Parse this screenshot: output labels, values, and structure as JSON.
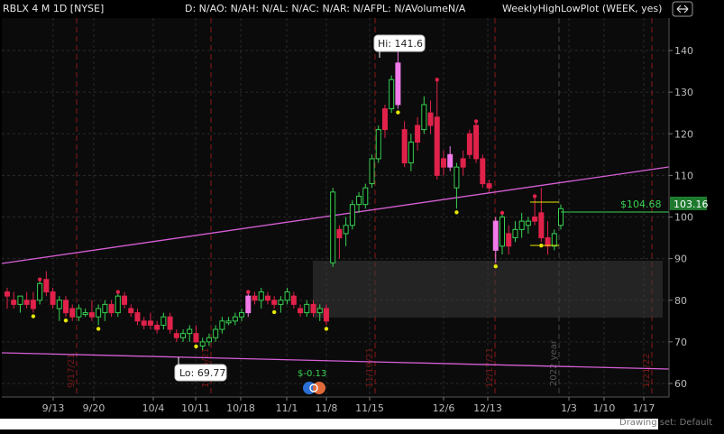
{
  "header": {
    "symbol": "RBLX 4 M 1D [NYSE]",
    "study_values": "D: N/AO: N/AH: N/AL: N/AC: N/AR: N/AFPL: N/AVolumeN/A",
    "study_name": "WeeklyHighLowPlot (WEEK, yes)"
  },
  "labels": {
    "hi": "Hi: 141.6",
    "lo": "Lo: 69.77",
    "price_level": "$104.68",
    "current_price": "103.16",
    "dividend_marker": "$-0.13",
    "year_marker": "2022 year",
    "drawing_set": "Drawing set: Default"
  },
  "y_axis": {
    "ticks": [
      "140",
      "130",
      "120",
      "110",
      "100",
      "90",
      "80",
      "70",
      "60"
    ]
  },
  "x_axis": {
    "ticks": [
      "9/13",
      "9/20",
      "10/4",
      "10/11",
      "10/18",
      "11/1",
      "11/8",
      "11/15",
      "12/6",
      "12/13",
      "1/3",
      "1/10",
      "1/17"
    ]
  },
  "date_markers": [
    "9/17/21",
    "10/15/21",
    "11/19/21",
    "12/17/21",
    "1/21/22"
  ],
  "colors": {
    "up": "#39d353",
    "down": "#e0224a",
    "highlight_candle": "#f07be8",
    "trendline": "#d65fd6",
    "grid": "#2a2a2a",
    "session_lines": "#8b1a1a",
    "high_dot": "#e0224a",
    "low_dot": "#e6e600"
  },
  "chart_data": {
    "type": "candlestick",
    "y_range": [
      57,
      147
    ],
    "candles": [
      {
        "o": 81,
        "h": 83,
        "l": 78,
        "c": 82,
        "up": false
      },
      {
        "o": 80,
        "h": 82,
        "l": 78,
        "c": 79,
        "up": false
      },
      {
        "o": 79,
        "h": 81,
        "l": 77,
        "c": 81,
        "up": true
      },
      {
        "o": 80,
        "h": 82,
        "l": 78,
        "c": 79,
        "up": false
      },
      {
        "o": 80,
        "h": 82,
        "l": 77,
        "c": 78,
        "up": false
      },
      {
        "o": 80,
        "h": 85,
        "l": 79,
        "c": 84,
        "up": true
      },
      {
        "o": 85,
        "h": 87,
        "l": 81,
        "c": 82,
        "up": false
      },
      {
        "o": 82,
        "h": 83,
        "l": 78,
        "c": 79,
        "up": false
      },
      {
        "o": 78,
        "h": 81,
        "l": 75,
        "c": 80,
        "up": true
      },
      {
        "o": 80,
        "h": 81,
        "l": 76,
        "c": 77,
        "up": false
      },
      {
        "o": 78,
        "h": 79,
        "l": 75,
        "c": 76,
        "up": false
      },
      {
        "o": 76,
        "h": 79,
        "l": 75,
        "c": 78,
        "up": true
      },
      {
        "o": 77,
        "h": 78,
        "l": 76,
        "c": 77,
        "up": true
      },
      {
        "o": 77,
        "h": 80,
        "l": 75,
        "c": 76,
        "up": false
      },
      {
        "o": 76,
        "h": 79,
        "l": 74,
        "c": 78,
        "up": true
      },
      {
        "o": 77,
        "h": 80,
        "l": 75,
        "c": 79,
        "up": true
      },
      {
        "o": 79,
        "h": 80,
        "l": 76,
        "c": 77,
        "up": false
      },
      {
        "o": 77,
        "h": 82,
        "l": 76,
        "c": 81,
        "up": true
      },
      {
        "o": 81,
        "h": 82,
        "l": 78,
        "c": 79,
        "up": false
      },
      {
        "o": 78,
        "h": 79,
        "l": 76,
        "c": 77,
        "up": false
      },
      {
        "o": 77,
        "h": 78,
        "l": 74,
        "c": 75,
        "up": false
      },
      {
        "o": 75,
        "h": 76,
        "l": 73,
        "c": 74,
        "up": false
      },
      {
        "o": 75,
        "h": 77,
        "l": 73,
        "c": 74,
        "up": false
      },
      {
        "o": 74,
        "h": 75,
        "l": 72,
        "c": 73,
        "up": false
      },
      {
        "o": 74,
        "h": 77,
        "l": 73,
        "c": 76,
        "up": true
      },
      {
        "o": 76,
        "h": 77,
        "l": 72,
        "c": 73,
        "up": false
      },
      {
        "o": 72,
        "h": 73,
        "l": 70,
        "c": 71,
        "up": false
      },
      {
        "o": 71,
        "h": 73,
        "l": 70,
        "c": 72,
        "up": true
      },
      {
        "o": 72,
        "h": 74,
        "l": 70,
        "c": 73,
        "up": true
      },
      {
        "o": 72,
        "h": 74,
        "l": 69.77,
        "c": 70,
        "up": false
      },
      {
        "o": 69,
        "h": 71,
        "l": 68,
        "c": 70,
        "up": true
      },
      {
        "o": 70,
        "h": 72,
        "l": 69,
        "c": 71,
        "up": true
      },
      {
        "o": 71,
        "h": 74,
        "l": 70,
        "c": 73,
        "up": true
      },
      {
        "o": 73,
        "h": 76,
        "l": 72,
        "c": 75,
        "up": true
      },
      {
        "o": 75,
        "h": 76,
        "l": 74,
        "c": 75,
        "up": true
      },
      {
        "o": 75,
        "h": 77,
        "l": 74,
        "c": 76,
        "up": true
      },
      {
        "o": 76,
        "h": 78,
        "l": 75,
        "c": 77,
        "up": true
      },
      {
        "o": 77,
        "h": 82,
        "l": 76,
        "c": 81,
        "up": true,
        "hl": true
      },
      {
        "o": 81,
        "h": 82,
        "l": 79,
        "c": 80,
        "up": false
      },
      {
        "o": 80,
        "h": 83,
        "l": 78,
        "c": 82,
        "up": true
      },
      {
        "o": 81,
        "h": 82,
        "l": 79,
        "c": 80,
        "up": false
      },
      {
        "o": 80,
        "h": 81,
        "l": 78,
        "c": 79,
        "up": false
      },
      {
        "o": 79,
        "h": 81,
        "l": 77,
        "c": 80,
        "up": true
      },
      {
        "o": 80,
        "h": 83,
        "l": 79,
        "c": 82,
        "up": true
      },
      {
        "o": 81,
        "h": 82,
        "l": 78,
        "c": 79,
        "up": false
      },
      {
        "o": 78,
        "h": 79,
        "l": 76,
        "c": 77,
        "up": false
      },
      {
        "o": 77,
        "h": 80,
        "l": 76,
        "c": 79,
        "up": true
      },
      {
        "o": 79,
        "h": 80,
        "l": 76,
        "c": 77,
        "up": false
      },
      {
        "o": 77,
        "h": 79,
        "l": 75,
        "c": 78,
        "up": true
      },
      {
        "o": 78,
        "h": 79,
        "l": 74,
        "c": 75,
        "up": false
      },
      {
        "o": 89,
        "h": 107,
        "l": 88,
        "c": 106,
        "up": true
      },
      {
        "o": 95,
        "h": 98,
        "l": 90,
        "c": 97,
        "up": false
      },
      {
        "o": 96,
        "h": 100,
        "l": 93,
        "c": 98,
        "up": true
      },
      {
        "o": 98,
        "h": 104,
        "l": 97,
        "c": 103,
        "up": true
      },
      {
        "o": 103,
        "h": 106,
        "l": 101,
        "c": 105,
        "up": true
      },
      {
        "o": 103,
        "h": 108,
        "l": 102,
        "c": 107,
        "up": true
      },
      {
        "o": 108,
        "h": 115,
        "l": 107,
        "c": 114,
        "up": true
      },
      {
        "o": 114,
        "h": 122,
        "l": 113,
        "c": 121,
        "up": true
      },
      {
        "o": 121,
        "h": 127,
        "l": 119,
        "c": 126,
        "up": false
      },
      {
        "o": 126,
        "h": 134,
        "l": 125,
        "c": 133,
        "up": true
      },
      {
        "o": 127,
        "h": 141.6,
        "l": 126,
        "c": 137,
        "up": true,
        "hl": true
      },
      {
        "o": 121,
        "h": 123,
        "l": 112,
        "c": 113,
        "up": false
      },
      {
        "o": 113,
        "h": 120,
        "l": 111,
        "c": 118,
        "up": true
      },
      {
        "o": 118,
        "h": 124,
        "l": 116,
        "c": 122,
        "up": false
      },
      {
        "o": 121,
        "h": 129,
        "l": 120,
        "c": 127,
        "up": true
      },
      {
        "o": 125,
        "h": 128,
        "l": 120,
        "c": 122,
        "up": false
      },
      {
        "o": 124,
        "h": 133,
        "l": 109,
        "c": 110,
        "up": false
      },
      {
        "o": 112,
        "h": 116,
        "l": 110,
        "c": 114,
        "up": false
      },
      {
        "o": 115,
        "h": 117,
        "l": 111,
        "c": 112,
        "up": false,
        "hl": true
      },
      {
        "o": 107,
        "h": 113,
        "l": 102,
        "c": 112,
        "up": true
      },
      {
        "o": 112,
        "h": 116,
        "l": 110,
        "c": 114,
        "up": false
      },
      {
        "o": 120,
        "h": 121,
        "l": 114,
        "c": 115,
        "up": false
      },
      {
        "o": 122,
        "h": 123,
        "l": 113,
        "c": 114,
        "up": false
      },
      {
        "o": 114,
        "h": 115,
        "l": 107,
        "c": 108,
        "up": false
      },
      {
        "o": 108,
        "h": 109,
        "l": 106,
        "c": 107,
        "up": false
      },
      {
        "o": 99,
        "h": 100,
        "l": 89,
        "c": 92,
        "up": false,
        "hl": true
      },
      {
        "o": 93,
        "h": 101,
        "l": 91,
        "c": 100,
        "up": true
      },
      {
        "o": 96,
        "h": 98,
        "l": 91,
        "c": 93,
        "up": false
      },
      {
        "o": 95,
        "h": 99,
        "l": 94,
        "c": 97,
        "up": true
      },
      {
        "o": 97,
        "h": 101,
        "l": 95,
        "c": 99,
        "up": true
      },
      {
        "o": 99,
        "h": 100,
        "l": 96,
        "c": 98,
        "up": true
      },
      {
        "o": 99,
        "h": 105,
        "l": 98,
        "c": 100,
        "up": false
      },
      {
        "o": 101,
        "h": 107,
        "l": 94,
        "c": 95,
        "up": false
      },
      {
        "o": 95,
        "h": 99,
        "l": 91,
        "c": 93,
        "up": false
      },
      {
        "o": 93,
        "h": 97,
        "l": 92,
        "c": 96,
        "up": true
      },
      {
        "o": 98,
        "h": 103,
        "l": 97,
        "c": 102,
        "up": true
      }
    ]
  }
}
